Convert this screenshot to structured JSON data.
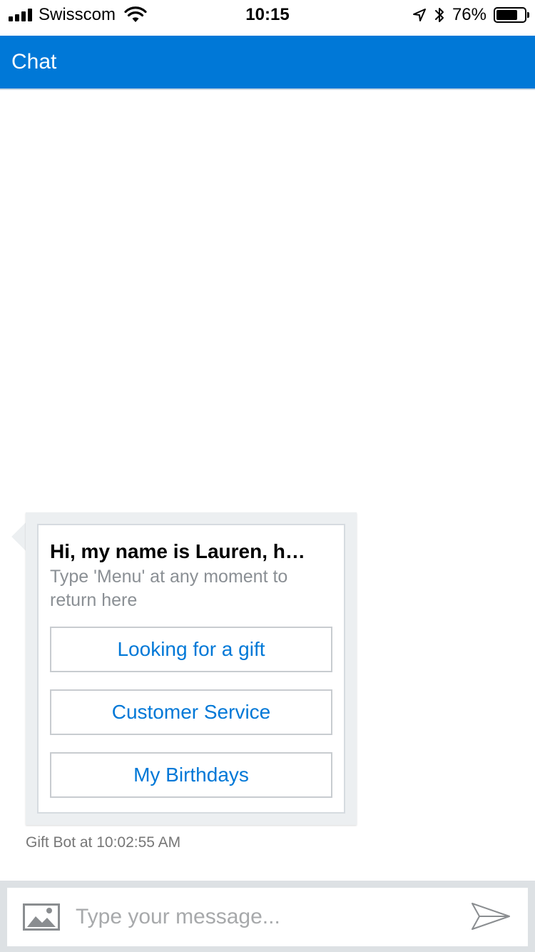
{
  "status_bar": {
    "carrier": "Swisscom",
    "time": "10:15",
    "battery_percent": "76%",
    "battery_level": 0.76,
    "icons": [
      "signal-icon",
      "wifi-icon",
      "location-arrow-icon",
      "bluetooth-icon",
      "battery-icon"
    ]
  },
  "header": {
    "title": "Chat",
    "background_color": "#0078d7"
  },
  "message": {
    "card": {
      "title": "Hi, my name is Lauren, h…",
      "subtitle": "Type 'Menu' at any moment to return here",
      "buttons": [
        {
          "label": "Looking for a gift"
        },
        {
          "label": "Customer Service"
        },
        {
          "label": "My Birthdays"
        }
      ]
    },
    "timestamp": "Gift Bot at 10:02:55 AM"
  },
  "composer": {
    "placeholder": "Type your message...",
    "value": "",
    "icons": [
      "image-upload-icon",
      "send-icon"
    ]
  },
  "colors": {
    "accent": "#0078d7",
    "bubble": "#eceff1",
    "composer_bar": "#dde1e4"
  }
}
